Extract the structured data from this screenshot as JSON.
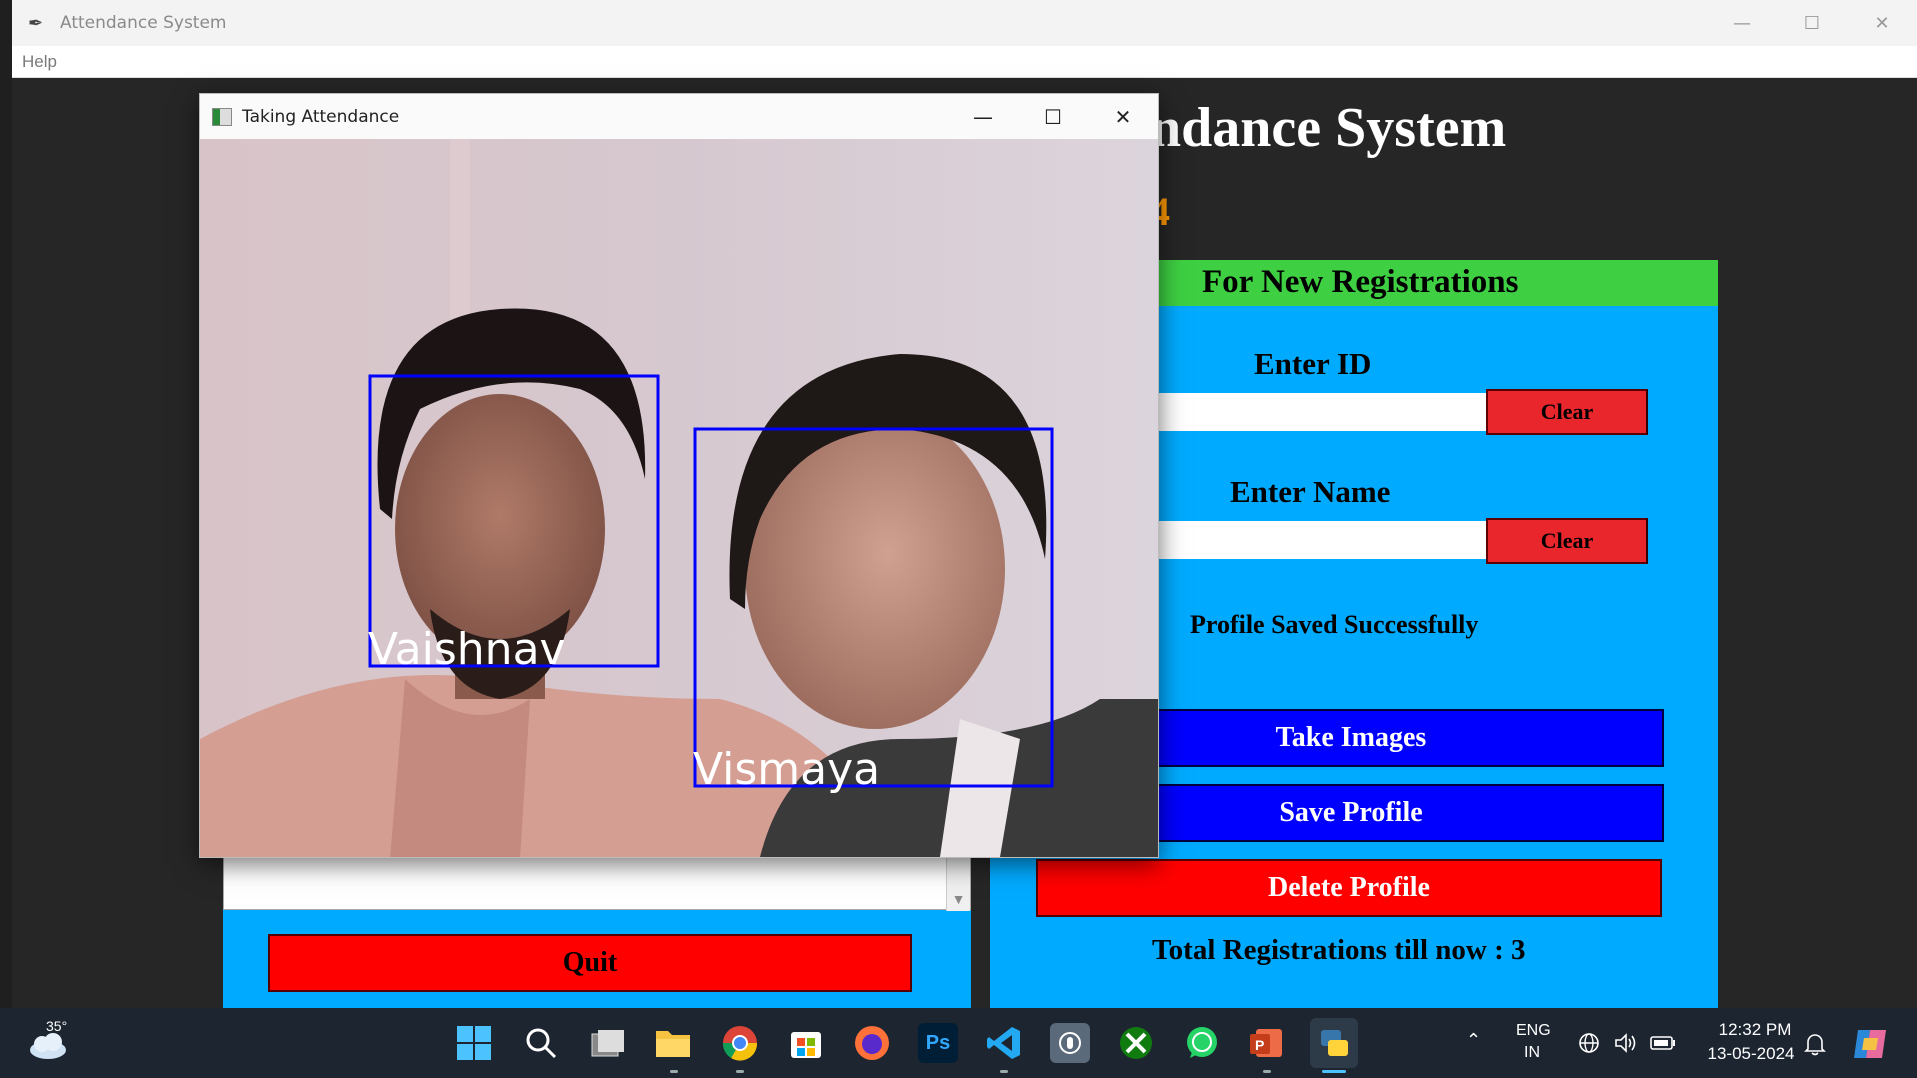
{
  "main_window": {
    "title": "Attendance System",
    "menu": [
      "Help"
    ],
    "heading": "ndance System",
    "date_fragment": "4"
  },
  "registration": {
    "header": "For New Registrations",
    "enter_id_label": "Enter ID",
    "id_value": "",
    "clear_label": "Clear",
    "enter_name_label": "Enter Name",
    "name_value": "",
    "status_message": "Profile Saved Successfully",
    "take_images_label": "Take Images",
    "save_profile_label": "Save Profile",
    "delete_profile_label": "Delete Profile",
    "total_label": "Total Registrations till now  : 3"
  },
  "attendance_panel": {
    "quit_label": "Quit"
  },
  "camera_window": {
    "title": "Taking Attendance",
    "detections": [
      "Vaishnav",
      "Vismaya"
    ]
  },
  "taskbar": {
    "weather_temp": "35°",
    "apps": [
      "windows-start",
      "search",
      "task-view",
      "file-explorer",
      "chrome",
      "microsoft-store",
      "firefox",
      "photoshop",
      "vscode",
      "app-unknown",
      "xbox",
      "whatsapp",
      "powerpoint",
      "python"
    ],
    "photoshop_label": "Ps",
    "language_top": "ENG",
    "language_bottom": "IN",
    "time": "12:32 PM",
    "date": "13-05-2024"
  },
  "colors": {
    "panel_blue": "#00aaff",
    "header_green": "#3ecf42",
    "button_blue": "#0000ff",
    "button_red": "#ff0000",
    "clear_red": "#e8262c",
    "date_orange": "#ff9900",
    "face_box": "#0000ff"
  }
}
